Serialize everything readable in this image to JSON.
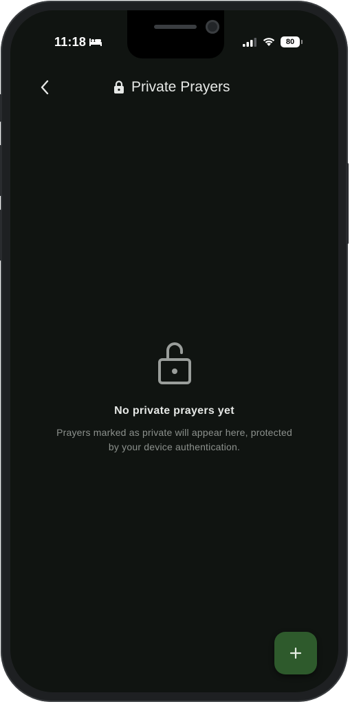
{
  "status_bar": {
    "time": "11:18",
    "battery": "80"
  },
  "header": {
    "title": "Private Prayers"
  },
  "empty_state": {
    "title": "No private prayers yet",
    "description": "Prayers marked as private will appear here, protected by your device authentication."
  },
  "fab": {
    "icon": "plus-icon"
  },
  "colors": {
    "background": "#101411",
    "fab": "#2e5a2c",
    "text_primary": "#e6e8e6",
    "text_secondary": "#8c918d"
  }
}
